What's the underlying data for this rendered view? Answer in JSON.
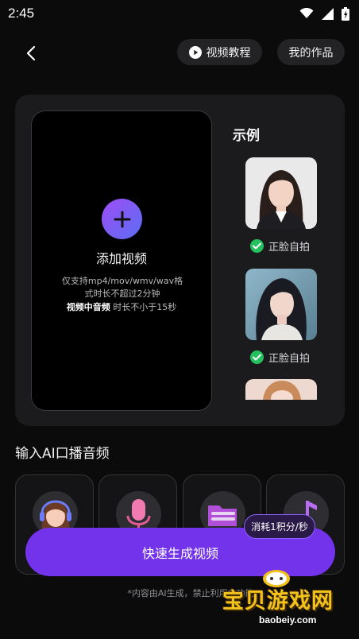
{
  "status_bar": {
    "time": "2:45"
  },
  "header": {
    "tutorial_label": "视频教程",
    "works_label": "我的作品"
  },
  "upload": {
    "title": "添加视频",
    "desc_line1": "仅支持mp4/mov/wmv/wav格",
    "desc_line2": "式时长不超过2分钟",
    "note_bold": "视频中音频",
    "note_rest": " 时长不小于15秒"
  },
  "examples": {
    "title": "示例",
    "items": [
      {
        "label": "正脸自拍"
      },
      {
        "label": "正脸自拍"
      }
    ]
  },
  "audio_section": {
    "title": "输入AI口播音频"
  },
  "generate": {
    "label": "快速生成视频",
    "cost": "消耗1积分/秒"
  },
  "disclaimer": "*内容由AI生成，禁止利用本功能",
  "watermark": {
    "title": "宝贝游戏网",
    "url": "baobeiy.com"
  },
  "colors": {
    "accent": "#7233ea",
    "check": "#25c05e",
    "watermark": "#f4c21c"
  }
}
